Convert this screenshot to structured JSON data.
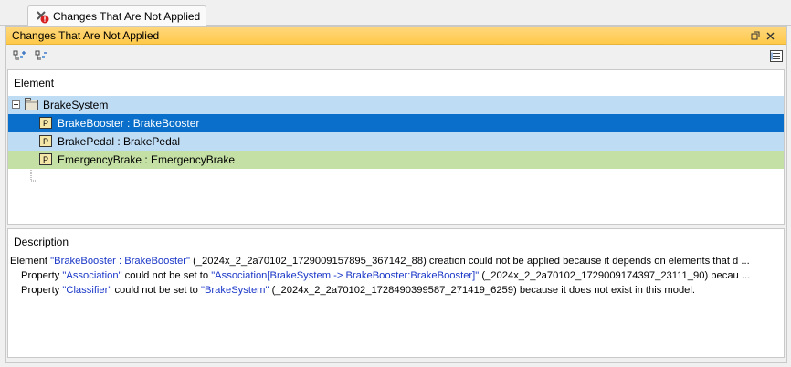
{
  "tab": {
    "label": "Changes That Are Not Applied"
  },
  "panel": {
    "title": "Changes That Are Not Applied",
    "icons": [
      "float-window-icon",
      "close-icon",
      "expand-all-icon",
      "collapse-all-icon",
      "details-view-icon"
    ]
  },
  "tree": {
    "column_header": "Element",
    "root": {
      "label": "BrakeSystem",
      "icon": "package-icon"
    },
    "children": [
      {
        "label": "BrakeBooster : BrakeBooster",
        "icon": "part-property-icon"
      },
      {
        "label": "BrakePedal : BrakePedal",
        "icon": "part-property-icon"
      },
      {
        "label": "EmergencyBrake : EmergencyBrake",
        "icon": "part-property-icon"
      }
    ]
  },
  "description": {
    "header": "Description",
    "line1": {
      "prefix": "Element ",
      "element": "\"BrakeBooster : BrakeBooster\"",
      "rest": " (_2024x_2_2a70102_1729009157895_367142_88) creation could not be applied because it depends on elements that d ..."
    },
    "line2": {
      "prefix": "Property ",
      "property": "\"Association\"",
      "mid": " could not be set to ",
      "value": "\"Association[BrakeSystem -> BrakeBooster:BrakeBooster]\"",
      "rest": " (_2024x_2_2a70102_1729009174397_23111_90) becau ..."
    },
    "line3": {
      "prefix": "Property ",
      "property": "\"Classifier\"",
      "mid": " could not be set to ",
      "value": "\"BrakeSystem\"",
      "rest": " (_2024x_2_2a70102_1728490399587_271419_6259) because it does not exist in this model."
    }
  },
  "colors": {
    "selected_row": "#0a6fca",
    "light_row": "#bfdcf5",
    "green_row": "#c5e0a5",
    "title_bar": "#ffd060",
    "link_text": "#1a37c8"
  }
}
